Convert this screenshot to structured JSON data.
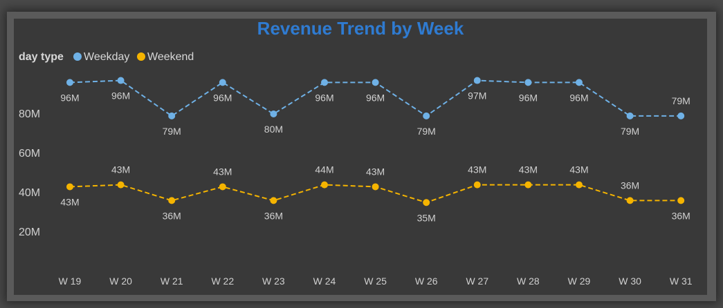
{
  "colors": {
    "title": "#2f7bd1",
    "weekday": "#6fb1e6",
    "weekend": "#f5b400"
  },
  "chart_data": {
    "type": "line",
    "title": "Revenue Trend by Week",
    "legend_title": "day type",
    "legend_position": "top-left",
    "x": [
      "W 19",
      "W 20",
      "W 21",
      "W 22",
      "W 23",
      "W 24",
      "W 25",
      "W 26",
      "W 27",
      "W 28",
      "W 29",
      "W 30",
      "W 31"
    ],
    "y_ticks": [
      "80M",
      "60M",
      "40M",
      "20M"
    ],
    "ylim": [
      0,
      110
    ],
    "series": [
      {
        "name": "Weekday",
        "color": "#6fb1e6",
        "values": [
          96,
          97,
          79,
          96,
          80,
          96,
          96,
          79,
          97,
          96,
          96,
          79,
          79
        ],
        "labels": [
          "96M",
          "96M",
          "79M",
          "96M",
          "80M",
          "96M",
          "96M",
          "79M",
          "97M",
          "96M",
          "96M",
          "79M",
          "79M"
        ],
        "label_pos": [
          "below",
          "below",
          "below",
          "below",
          "below",
          "below",
          "below",
          "below",
          "below",
          "below",
          "below",
          "below",
          "above"
        ]
      },
      {
        "name": "Weekend",
        "color": "#f5b400",
        "values": [
          43,
          44,
          36,
          43,
          36,
          44,
          43,
          35,
          44,
          44,
          44,
          36,
          36
        ],
        "labels": [
          "43M",
          "43M",
          "36M",
          "43M",
          "36M",
          "44M",
          "43M",
          "35M",
          "43M",
          "43M",
          "43M",
          "36M",
          "36M"
        ],
        "label_pos": [
          "below",
          "above",
          "below",
          "above",
          "below",
          "above",
          "above",
          "below",
          "above",
          "above",
          "above",
          "above",
          "below"
        ]
      }
    ]
  }
}
